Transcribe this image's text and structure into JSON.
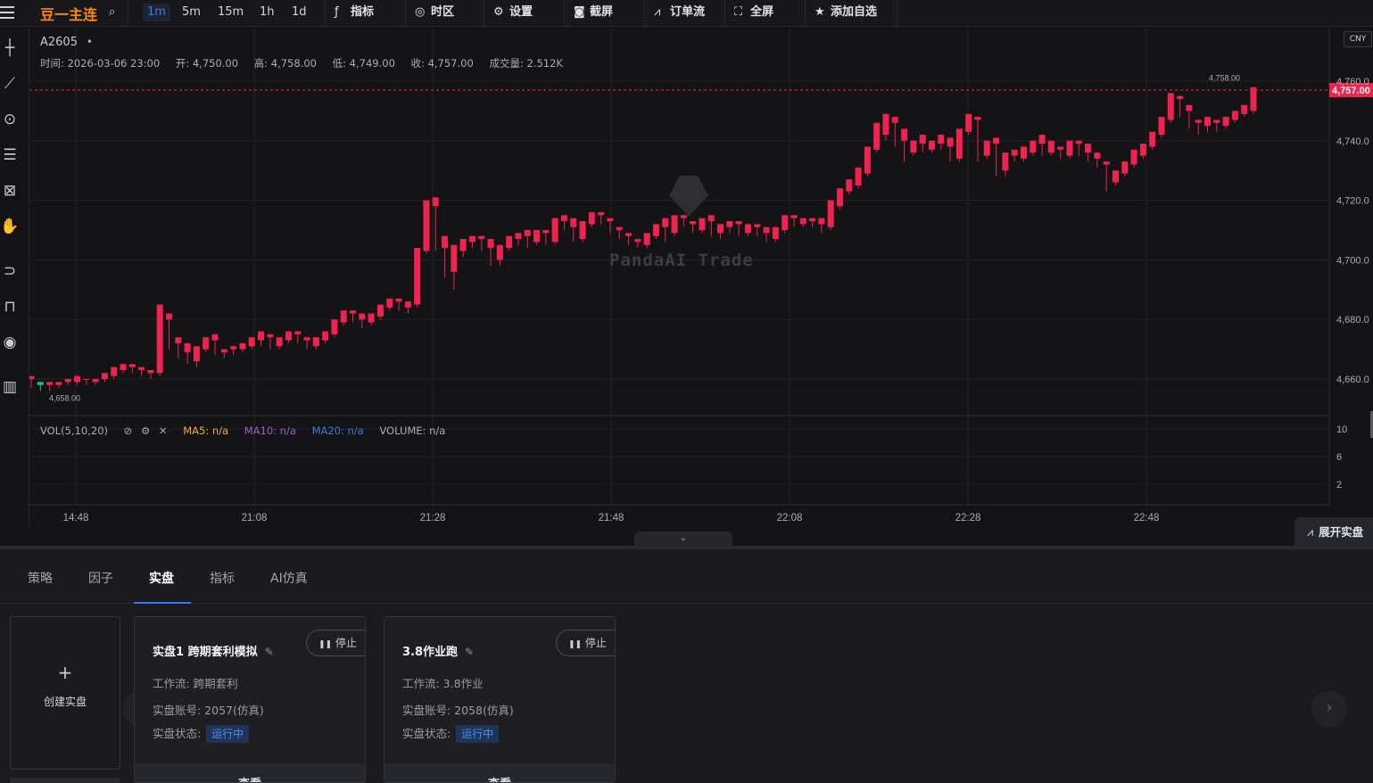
{
  "toolbar": {
    "symbol_name": "豆一主连",
    "intervals": [
      {
        "label": "1m",
        "active": true
      },
      {
        "label": "5m",
        "active": false
      },
      {
        "label": "15m",
        "active": false
      },
      {
        "label": "1h",
        "active": false
      },
      {
        "label": "1d",
        "active": false
      }
    ],
    "indicators_label": "指标",
    "timezone_label": "时区",
    "settings_label": "设置",
    "screenshot_label": "截屏",
    "orderflow_label": "订单流",
    "fullscreen_label": "全屏",
    "watchlist_label": "添加自选"
  },
  "chart": {
    "symbol_code": "A2605",
    "ohlc": {
      "time": "时间: 2026-03-06 23:00",
      "open": "开: 4,750.00",
      "high": "高: 4,758.00",
      "low": "低: 4,749.00",
      "close": "收: 4,757.00",
      "volume": "成交量: 2.512K"
    },
    "currency": "CNY",
    "current_price": "4,757.00",
    "max_label": "4,758.00",
    "min_label": "4,658.00",
    "watermark": "PandaAI Trade",
    "price_ticks": [
      "4,760.0",
      "4,740.0",
      "4,720.0",
      "4,700.0",
      "4,680.0",
      "4,660.0"
    ],
    "volume_ticks": [
      "10",
      "6",
      "2"
    ],
    "time_ticks": [
      "14:48",
      "21:08",
      "21:28",
      "21:48",
      "22:08",
      "22:28",
      "22:48"
    ],
    "volume_legend": {
      "name": "VOL(5,10,20)",
      "ma5": "MA5: n/a",
      "ma10": "MA10: n/a",
      "ma20": "MA20: n/a",
      "volume": "VOLUME: n/a"
    },
    "colors": {
      "up": "#f0234f",
      "down": "#26c08a",
      "ma5": "#f3a43c",
      "ma10": "#a55cc8",
      "ma20": "#3b7bd8",
      "price_tag": "#f0234f"
    }
  },
  "chart_data": {
    "type": "candlestick",
    "x_ticks": [
      "14:48",
      "21:08",
      "21:28",
      "21:48",
      "22:08",
      "22:28",
      "22:48"
    ],
    "ylim": [
      4655,
      4762
    ],
    "last_close": 4757,
    "high": 4758,
    "low": 4658,
    "candles": [
      [
        4660,
        4661,
        4657,
        4659
      ],
      [
        4659,
        4658,
        4656,
        4657
      ],
      [
        4658,
        4659,
        4656,
        4657
      ],
      [
        4658,
        4659,
        4657,
        4659
      ],
      [
        4659,
        4660,
        4658,
        4659
      ],
      [
        4659,
        4661,
        4658,
        4660
      ],
      [
        4660,
        4660,
        4658,
        4659
      ],
      [
        4659,
        4660,
        4658,
        4660
      ],
      [
        4660,
        4662,
        4659,
        4661
      ],
      [
        4661,
        4664,
        4660,
        4663
      ],
      [
        4663,
        4665,
        4662,
        4664
      ],
      [
        4664,
        4665,
        4662,
        4663
      ],
      [
        4663,
        4664,
        4661,
        4662
      ],
      [
        4662,
        4663,
        4660,
        4661
      ],
      [
        4662,
        4685,
        4661,
        4680
      ],
      [
        4680,
        4682,
        4670,
        4672
      ],
      [
        4672,
        4674,
        4667,
        4669
      ],
      [
        4669,
        4672,
        4665,
        4666
      ],
      [
        4666,
        4671,
        4664,
        4670
      ],
      [
        4670,
        4674,
        4669,
        4673
      ],
      [
        4673,
        4675,
        4668,
        4669
      ],
      [
        4669,
        4670,
        4667,
        4670
      ],
      [
        4670,
        4671,
        4668,
        4669
      ],
      [
        4670,
        4672,
        4669,
        4671
      ],
      [
        4671,
        4674,
        4670,
        4673
      ],
      [
        4673,
        4676,
        4671,
        4674
      ],
      [
        4674,
        4675,
        4670,
        4671
      ],
      [
        4671,
        4674,
        4670,
        4673
      ],
      [
        4673,
        4676,
        4672,
        4675
      ],
      [
        4675,
        4676,
        4672,
        4673
      ],
      [
        4673,
        4674,
        4670,
        4671
      ],
      [
        4671,
        4674,
        4670,
        4673
      ],
      [
        4673,
        4676,
        4672,
        4675
      ],
      [
        4675,
        4680,
        4674,
        4679
      ],
      [
        4679,
        4683,
        4678,
        4682
      ],
      [
        4682,
        4683,
        4679,
        4680
      ],
      [
        4680,
        4682,
        4677,
        4679
      ],
      [
        4679,
        4682,
        4678,
        4681
      ],
      [
        4681,
        4685,
        4680,
        4684
      ],
      [
        4684,
        4687,
        4683,
        4686
      ],
      [
        4686,
        4687,
        4683,
        4684
      ],
      [
        4684,
        4686,
        4682,
        4685
      ],
      [
        4685,
        4704,
        4684,
        4703
      ],
      [
        4703,
        4720,
        4702,
        4718
      ],
      [
        4718,
        4721,
        4703,
        4704
      ],
      [
        4704,
        4708,
        4694,
        4696
      ],
      [
        4696,
        4705,
        4690,
        4703
      ],
      [
        4703,
        4707,
        4701,
        4706
      ],
      [
        4706,
        4708,
        4704,
        4707
      ],
      [
        4707,
        4708,
        4703,
        4704
      ],
      [
        4704,
        4707,
        4698,
        4700
      ],
      [
        4700,
        4705,
        4698,
        4704
      ],
      [
        4704,
        4708,
        4703,
        4707
      ],
      [
        4707,
        4709,
        4705,
        4708
      ],
      [
        4708,
        4710,
        4704,
        4706
      ],
      [
        4706,
        4710,
        4705,
        4709
      ],
      [
        4709,
        4710,
        4705,
        4706
      ],
      [
        4706,
        4714,
        4705,
        4713
      ],
      [
        4713,
        4715,
        4710,
        4711
      ],
      [
        4711,
        4714,
        4706,
        4707
      ],
      [
        4707,
        4713,
        4706,
        4712
      ],
      [
        4712,
        4716,
        4711,
        4715
      ],
      [
        4715,
        4716,
        4712,
        4713
      ],
      [
        4713,
        4714,
        4709,
        4710
      ],
      [
        4710,
        4711,
        4707,
        4708
      ],
      [
        4708,
        4709,
        4705,
        4706
      ],
      [
        4706,
        4707,
        4704,
        4705
      ],
      [
        4705,
        4709,
        4704,
        4708
      ],
      [
        4708,
        4712,
        4707,
        4711
      ],
      [
        4711,
        4714,
        4706,
        4709
      ],
      [
        4709,
        4715,
        4708,
        4714
      ],
      [
        4714,
        4715,
        4711,
        4712
      ],
      [
        4712,
        4713,
        4709,
        4710
      ],
      [
        4710,
        4714,
        4709,
        4713
      ],
      [
        4713,
        4715,
        4708,
        4709
      ],
      [
        4709,
        4712,
        4707,
        4711
      ],
      [
        4711,
        4713,
        4709,
        4712
      ],
      [
        4712,
        4713,
        4708,
        4709
      ],
      [
        4709,
        4712,
        4708,
        4711
      ],
      [
        4711,
        4712,
        4708,
        4709
      ],
      [
        4709,
        4711,
        4706,
        4707
      ],
      [
        4707,
        4711,
        4706,
        4710
      ],
      [
        4710,
        4715,
        4709,
        4714
      ],
      [
        4714,
        4715,
        4711,
        4712
      ],
      [
        4712,
        4714,
        4711,
        4713
      ],
      [
        4713,
        4714,
        4711,
        4712
      ],
      [
        4712,
        4714,
        4709,
        4711
      ],
      [
        4711,
        4720,
        4710,
        4718
      ],
      [
        4718,
        4724,
        4717,
        4723
      ],
      [
        4723,
        4727,
        4722,
        4725
      ],
      [
        4725,
        4731,
        4724,
        4729
      ],
      [
        4729,
        4738,
        4728,
        4737
      ],
      [
        4737,
        4746,
        4736,
        4742
      ],
      [
        4742,
        4749,
        4740,
        4746
      ],
      [
        4746,
        4748,
        4738,
        4740
      ],
      [
        4740,
        4744,
        4733,
        4736
      ],
      [
        4736,
        4740,
        4735,
        4739
      ],
      [
        4739,
        4742,
        4736,
        4737
      ],
      [
        4737,
        4740,
        4736,
        4739
      ],
      [
        4739,
        4742,
        4737,
        4738
      ],
      [
        4738,
        4741,
        4733,
        4734
      ],
      [
        4734,
        4744,
        4733,
        4743
      ],
      [
        4743,
        4749,
        4742,
        4747
      ],
      [
        4747,
        4748,
        4733,
        4735
      ],
      [
        4735,
        4740,
        4734,
        4739
      ],
      [
        4739,
        4741,
        4728,
        4730
      ],
      [
        4730,
        4736,
        4728,
        4735
      ],
      [
        4735,
        4737,
        4733,
        4734
      ],
      [
        4734,
        4738,
        4733,
        4736
      ],
      [
        4736,
        4740,
        4735,
        4739
      ],
      [
        4739,
        4742,
        4735,
        4736
      ],
      [
        4736,
        4740,
        4735,
        4737
      ],
      [
        4737,
        4738,
        4734,
        4735
      ],
      [
        4735,
        4740,
        4734,
        4739
      ],
      [
        4739,
        4740,
        4735,
        4736
      ],
      [
        4736,
        4739,
        4733,
        4734
      ],
      [
        4734,
        4736,
        4731,
        4732
      ],
      [
        4732,
        4733,
        4723,
        4726
      ],
      [
        4726,
        4730,
        4725,
        4729
      ],
      [
        4729,
        4733,
        4728,
        4732
      ],
      [
        4732,
        4737,
        4731,
        4735
      ],
      [
        4735,
        4739,
        4734,
        4738
      ],
      [
        4738,
        4743,
        4737,
        4742
      ],
      [
        4742,
        4748,
        4741,
        4747
      ],
      [
        4747,
        4756,
        4746,
        4754
      ],
      [
        4754,
        4755,
        4748,
        4750
      ],
      [
        4750,
        4752,
        4744,
        4746
      ],
      [
        4746,
        4747,
        4742,
        4745
      ],
      [
        4745,
        4748,
        4743,
        4746
      ],
      [
        4746,
        4747,
        4743,
        4745
      ],
      [
        4745,
        4748,
        4744,
        4747
      ],
      [
        4747,
        4750,
        4746,
        4749
      ],
      [
        4749,
        4752,
        4748,
        4751
      ],
      [
        4750,
        4758,
        4749,
        4757
      ]
    ]
  },
  "chart_tools": [
    "crosshair-icon",
    "trendline-icon",
    "circle-tool-icon",
    "fib-lines-icon",
    "pattern-icon",
    "hand-icon",
    "magnet-icon",
    "lock-icon",
    "eye-icon",
    "trash-icon"
  ],
  "panel": {
    "tabs": [
      {
        "label": "策略",
        "active": false
      },
      {
        "label": "因子",
        "active": false
      },
      {
        "label": "实盘",
        "active": true
      },
      {
        "label": "指标",
        "active": false
      },
      {
        "label": "AI仿真",
        "active": false
      }
    ],
    "create_label": "创建实盘",
    "expand_label": "展开实盘",
    "cards": [
      {
        "title": "实盘1 跨期套利模拟",
        "stop_label": "停止",
        "workflow": "工作流:  跨期套利",
        "account": "实盘账号:  2057(仿真)",
        "status_label": "实盘状态:",
        "status": "运行中",
        "view_label": "查看"
      },
      {
        "title": "3.8作业跑",
        "stop_label": "停止",
        "workflow": "工作流:  3.8作业",
        "account": "实盘账号:  2058(仿真)",
        "status_label": "实盘状态:",
        "status": "运行中",
        "view_label": "查看"
      }
    ]
  }
}
